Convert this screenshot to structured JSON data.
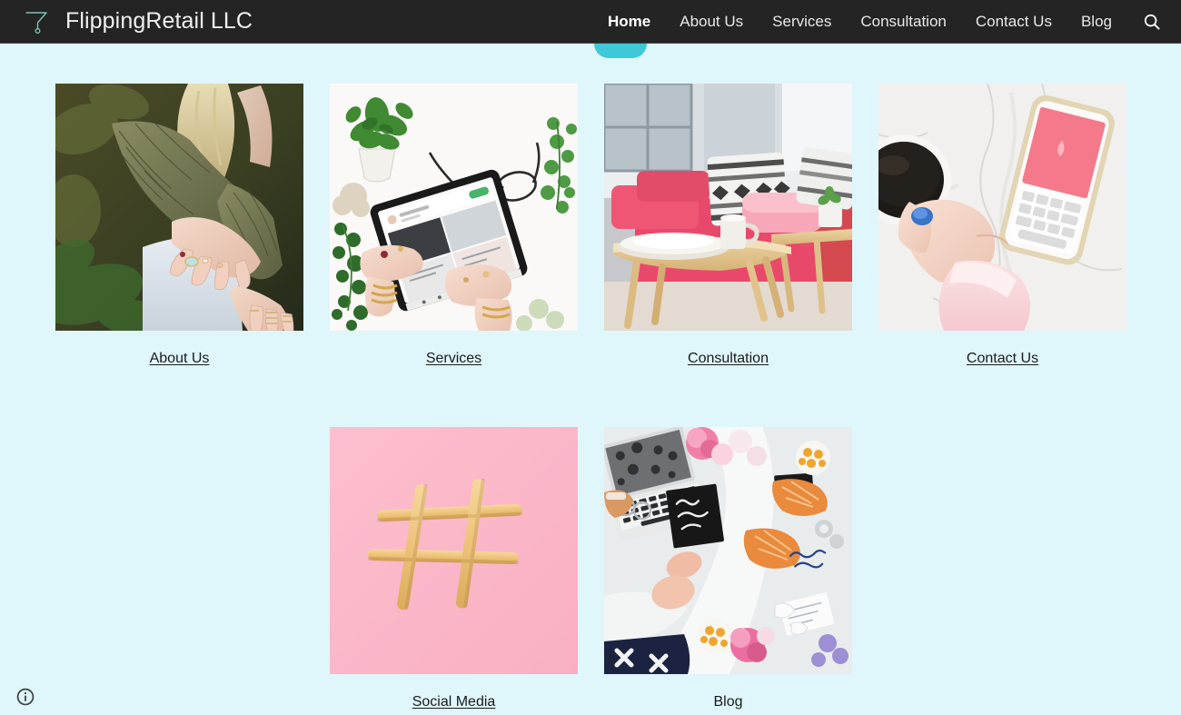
{
  "site": {
    "brand_name": "FlippingRetail LLC",
    "logo_icon": "funnel-glass-icon",
    "background_color": "#dff6fb",
    "navbar_color": "#242424",
    "accent_color": "#3fc8d8"
  },
  "nav": {
    "items": [
      {
        "label": "Home",
        "active": true
      },
      {
        "label": "About Us",
        "active": false
      },
      {
        "label": "Services",
        "active": false
      },
      {
        "label": "Consultation",
        "active": false
      },
      {
        "label": "Contact Us",
        "active": false
      },
      {
        "label": "Blog",
        "active": false
      }
    ],
    "search_icon": "search-icon"
  },
  "tiles": [
    {
      "label": "About Us",
      "underlined": true,
      "image": "woman-with-rings-outdoors"
    },
    {
      "label": "Services",
      "underlined": true,
      "image": "tablet-flatlay-with-plants"
    },
    {
      "label": "Consultation",
      "underlined": true,
      "image": "pink-sofa-wooden-table"
    },
    {
      "label": "Contact Us",
      "underlined": true,
      "image": "hand-coffee-phone-marble"
    },
    {
      "label": "Social Media",
      "underlined": true,
      "image": "hashtag-breadsticks-pink"
    },
    {
      "label": "Blog",
      "underlined": false,
      "image": "desk-flatlay-shoes-flowers"
    }
  ],
  "footer": {
    "info_icon": "info-circle-icon"
  }
}
